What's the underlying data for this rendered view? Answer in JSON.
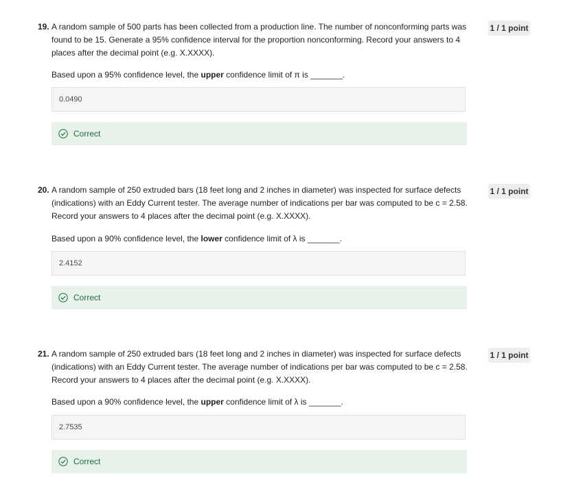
{
  "questions": [
    {
      "number": "19.",
      "text": "A random sample of 500 parts has been collected from a production line.  The number of nonconforming parts was found to be 15.  Generate a 95% confidence interval for the proportion nonconforming. Record your answers to 4 places after the decimal point (e.g. X.XXXX).",
      "prompt_before": "Based upon a 95% confidence level, the ",
      "prompt_bold": "upper",
      "prompt_after": " confidence limit of π is _______.",
      "answer": "0.0490",
      "feedback": "Correct",
      "score": "1 / 1 point"
    },
    {
      "number": "20.",
      "text": "A random sample of 250 extruded bars (18 feet long and 2 inches in diameter) was inspected for surface defects (indications) with an Eddy Current tester. The average number of indications per bar was computed to be c = 2.58. Record your answers to 4 places after the decimal point (e.g. X.XXXX).",
      "prompt_before": "Based upon a 90% confidence level, the ",
      "prompt_bold": "lower",
      "prompt_after": " confidence limit of λ is _______.",
      "answer": "2.4152",
      "feedback": "Correct",
      "score": "1 / 1 point"
    },
    {
      "number": "21.",
      "text": "A random sample of 250 extruded bars (18 feet long and 2 inches in diameter) was inspected for surface defects (indications) with an Eddy Current tester. The average number of indications per bar was computed to be c = 2.58. Record your answers to 4 places after the decimal point (e.g. X.XXXX).",
      "prompt_before": "Based upon a 90% confidence level, the ",
      "prompt_bold": "upper",
      "prompt_after": " confidence limit of λ is _______.",
      "answer": "2.7535",
      "feedback": "Correct",
      "score": "1 / 1 point"
    }
  ],
  "colors": {
    "correct_bg": "#e6f2ea",
    "correct_text": "#1e6b3a",
    "answer_bg": "#f5f5f5",
    "badge_bg": "#eeeeee"
  },
  "icons": {
    "feedback": "check-circle-icon"
  }
}
